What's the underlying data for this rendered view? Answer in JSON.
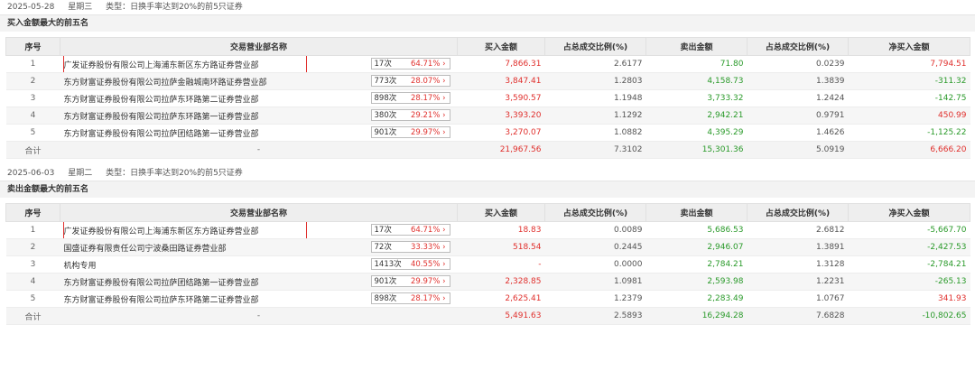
{
  "section1": {
    "date": "2025-05-28",
    "weekday": "星期三",
    "type_label": "类型：日换手率达到20%的前5只证券",
    "title": "买入金额最大的前五名",
    "headers": [
      "序号",
      "交易营业部名称",
      "买入金额",
      "占总成交比例(%)",
      "卖出金额",
      "占总成交比例(%)",
      "净买入金额"
    ],
    "rows": [
      {
        "idx": "1",
        "name": "广发证券股份有限公司上海浦东新区东方路证券营业部",
        "count": "17次",
        "pct": "64.71% ›",
        "buy": "7,866.31",
        "buy_ratio": "2.6177",
        "sell": "71.80",
        "sell_ratio": "0.0239",
        "net": "7,794.51"
      },
      {
        "idx": "2",
        "name": "东方财富证券股份有限公司拉萨金融城南环路证券营业部",
        "count": "773次",
        "pct": "28.07% ›",
        "buy": "3,847.41",
        "buy_ratio": "1.2803",
        "sell": "4,158.73",
        "sell_ratio": "1.3839",
        "net": "-311.32"
      },
      {
        "idx": "3",
        "name": "东方财富证券股份有限公司拉萨东环路第二证券营业部",
        "count": "898次",
        "pct": "28.17% ›",
        "buy": "3,590.57",
        "buy_ratio": "1.1948",
        "sell": "3,733.32",
        "sell_ratio": "1.2424",
        "net": "-142.75"
      },
      {
        "idx": "4",
        "name": "东方财富证券股份有限公司拉萨东环路第一证券营业部",
        "count": "380次",
        "pct": "29.21% ›",
        "buy": "3,393.20",
        "buy_ratio": "1.1292",
        "sell": "2,942.21",
        "sell_ratio": "0.9791",
        "net": "450.99"
      },
      {
        "idx": "5",
        "name": "东方财富证券股份有限公司拉萨团结路第一证券营业部",
        "count": "901次",
        "pct": "29.97% ›",
        "buy": "3,270.07",
        "buy_ratio": "1.0882",
        "sell": "4,395.29",
        "sell_ratio": "1.4626",
        "net": "-1,125.22"
      }
    ],
    "total": {
      "label": "合计",
      "name": "-",
      "buy": "21,967.56",
      "buy_ratio": "7.3102",
      "sell": "15,301.36",
      "sell_ratio": "5.0919",
      "net": "6,666.20"
    }
  },
  "section2": {
    "date": "2025-06-03",
    "weekday": "星期二",
    "type_label": "类型：日换手率达到20%的前5只证券",
    "title": "卖出金额最大的前五名",
    "headers": [
      "序号",
      "交易营业部名称",
      "买入金额",
      "占总成交比例(%)",
      "卖出金额",
      "占总成交比例(%)",
      "净买入金额"
    ],
    "rows": [
      {
        "idx": "1",
        "name": "广发证券股份有限公司上海浦东新区东方路证券营业部",
        "count": "17次",
        "pct": "64.71% ›",
        "buy": "18.83",
        "buy_ratio": "0.0089",
        "sell": "5,686.53",
        "sell_ratio": "2.6812",
        "net": "-5,667.70"
      },
      {
        "idx": "2",
        "name": "国盛证券有限责任公司宁波桑田路证券营业部",
        "count": "72次",
        "pct": "33.33% ›",
        "buy": "518.54",
        "buy_ratio": "0.2445",
        "sell": "2,946.07",
        "sell_ratio": "1.3891",
        "net": "-2,427.53"
      },
      {
        "idx": "3",
        "name": "机构专用",
        "count": "1413次",
        "pct": "40.55% ›",
        "buy": "-",
        "buy_ratio": "0.0000",
        "sell": "2,784.21",
        "sell_ratio": "1.3128",
        "net": "-2,784.21"
      },
      {
        "idx": "4",
        "name": "东方财富证券股份有限公司拉萨团结路第一证券营业部",
        "count": "901次",
        "pct": "29.97% ›",
        "buy": "2,328.85",
        "buy_ratio": "1.0981",
        "sell": "2,593.98",
        "sell_ratio": "1.2231",
        "net": "-265.13"
      },
      {
        "idx": "5",
        "name": "东方财富证券股份有限公司拉萨东环路第二证券营业部",
        "count": "898次",
        "pct": "28.17% ›",
        "buy": "2,625.41",
        "buy_ratio": "1.2379",
        "sell": "2,283.49",
        "sell_ratio": "1.0767",
        "net": "341.93"
      }
    ],
    "total": {
      "label": "合计",
      "name": "-",
      "buy": "5,491.63",
      "buy_ratio": "2.5893",
      "sell": "16,294.28",
      "sell_ratio": "7.6828",
      "net": "-10,802.65"
    }
  }
}
